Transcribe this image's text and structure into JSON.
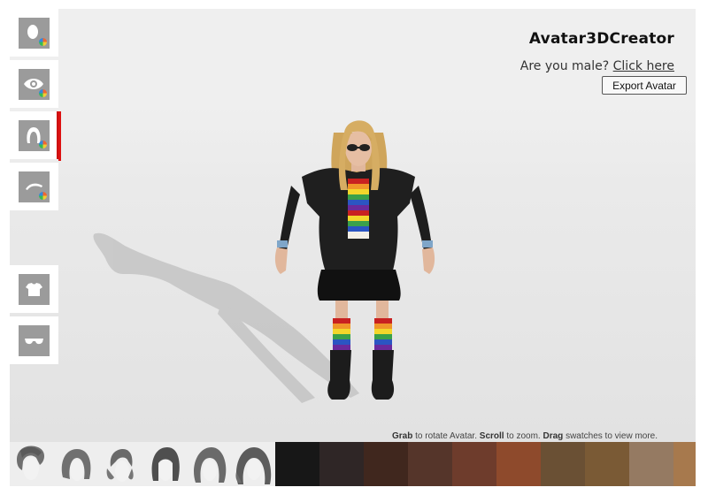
{
  "header": {
    "app_title": "Avatar3DCreator",
    "gender_prompt": "Are you male?",
    "gender_link": "Click here",
    "export_label": "Export Avatar"
  },
  "sidebar": {
    "items": [
      {
        "name": "skin-color",
        "icon": "head-icon",
        "active": false
      },
      {
        "name": "eye-color",
        "icon": "eye-icon",
        "active": false
      },
      {
        "name": "hair-style",
        "icon": "hair-icon",
        "active": true
      },
      {
        "name": "brow-color",
        "icon": "eyebrow-icon",
        "active": false
      },
      {
        "name": "outfit",
        "icon": "shirt-icon",
        "active": false
      },
      {
        "name": "accessories",
        "icon": "glasses-icon",
        "active": false
      }
    ]
  },
  "hint": {
    "grab": "Grab",
    "grab_text": "to rotate Avatar.",
    "scroll": "Scroll",
    "scroll_text": "to zoom.",
    "drag": "Drag",
    "drag_text": "swatches to view more."
  },
  "hair_styles": [
    "hair-style-1",
    "hair-style-2",
    "hair-style-3",
    "hair-style-4",
    "hair-style-5",
    "hair-style-6"
  ],
  "swatches": [
    "#171717",
    "#2f2626",
    "#40271e",
    "#55352a",
    "#6e3c2c",
    "#8e4a2c",
    "#6a5034",
    "#7a5a35",
    "#957a62",
    "#a7794d"
  ]
}
